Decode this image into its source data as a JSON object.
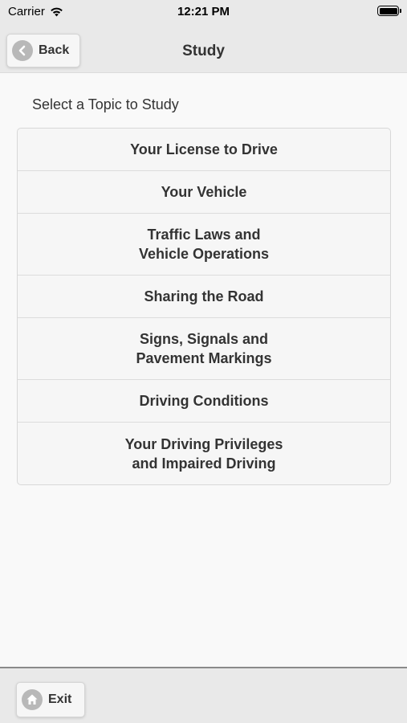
{
  "status": {
    "carrier": "Carrier",
    "time": "12:21 PM"
  },
  "header": {
    "title": "Study",
    "back_label": "Back"
  },
  "main": {
    "subtitle": "Select a Topic to Study",
    "topics": [
      {
        "label": "Your License to Drive"
      },
      {
        "label": "Your Vehicle"
      },
      {
        "label": "Traffic Laws and\nVehicle Operations"
      },
      {
        "label": "Sharing the Road"
      },
      {
        "label": "Signs, Signals and\nPavement Markings"
      },
      {
        "label": "Driving Conditions"
      },
      {
        "label": "Your Driving Privileges\nand Impaired Driving"
      }
    ]
  },
  "footer": {
    "exit_label": "Exit"
  }
}
